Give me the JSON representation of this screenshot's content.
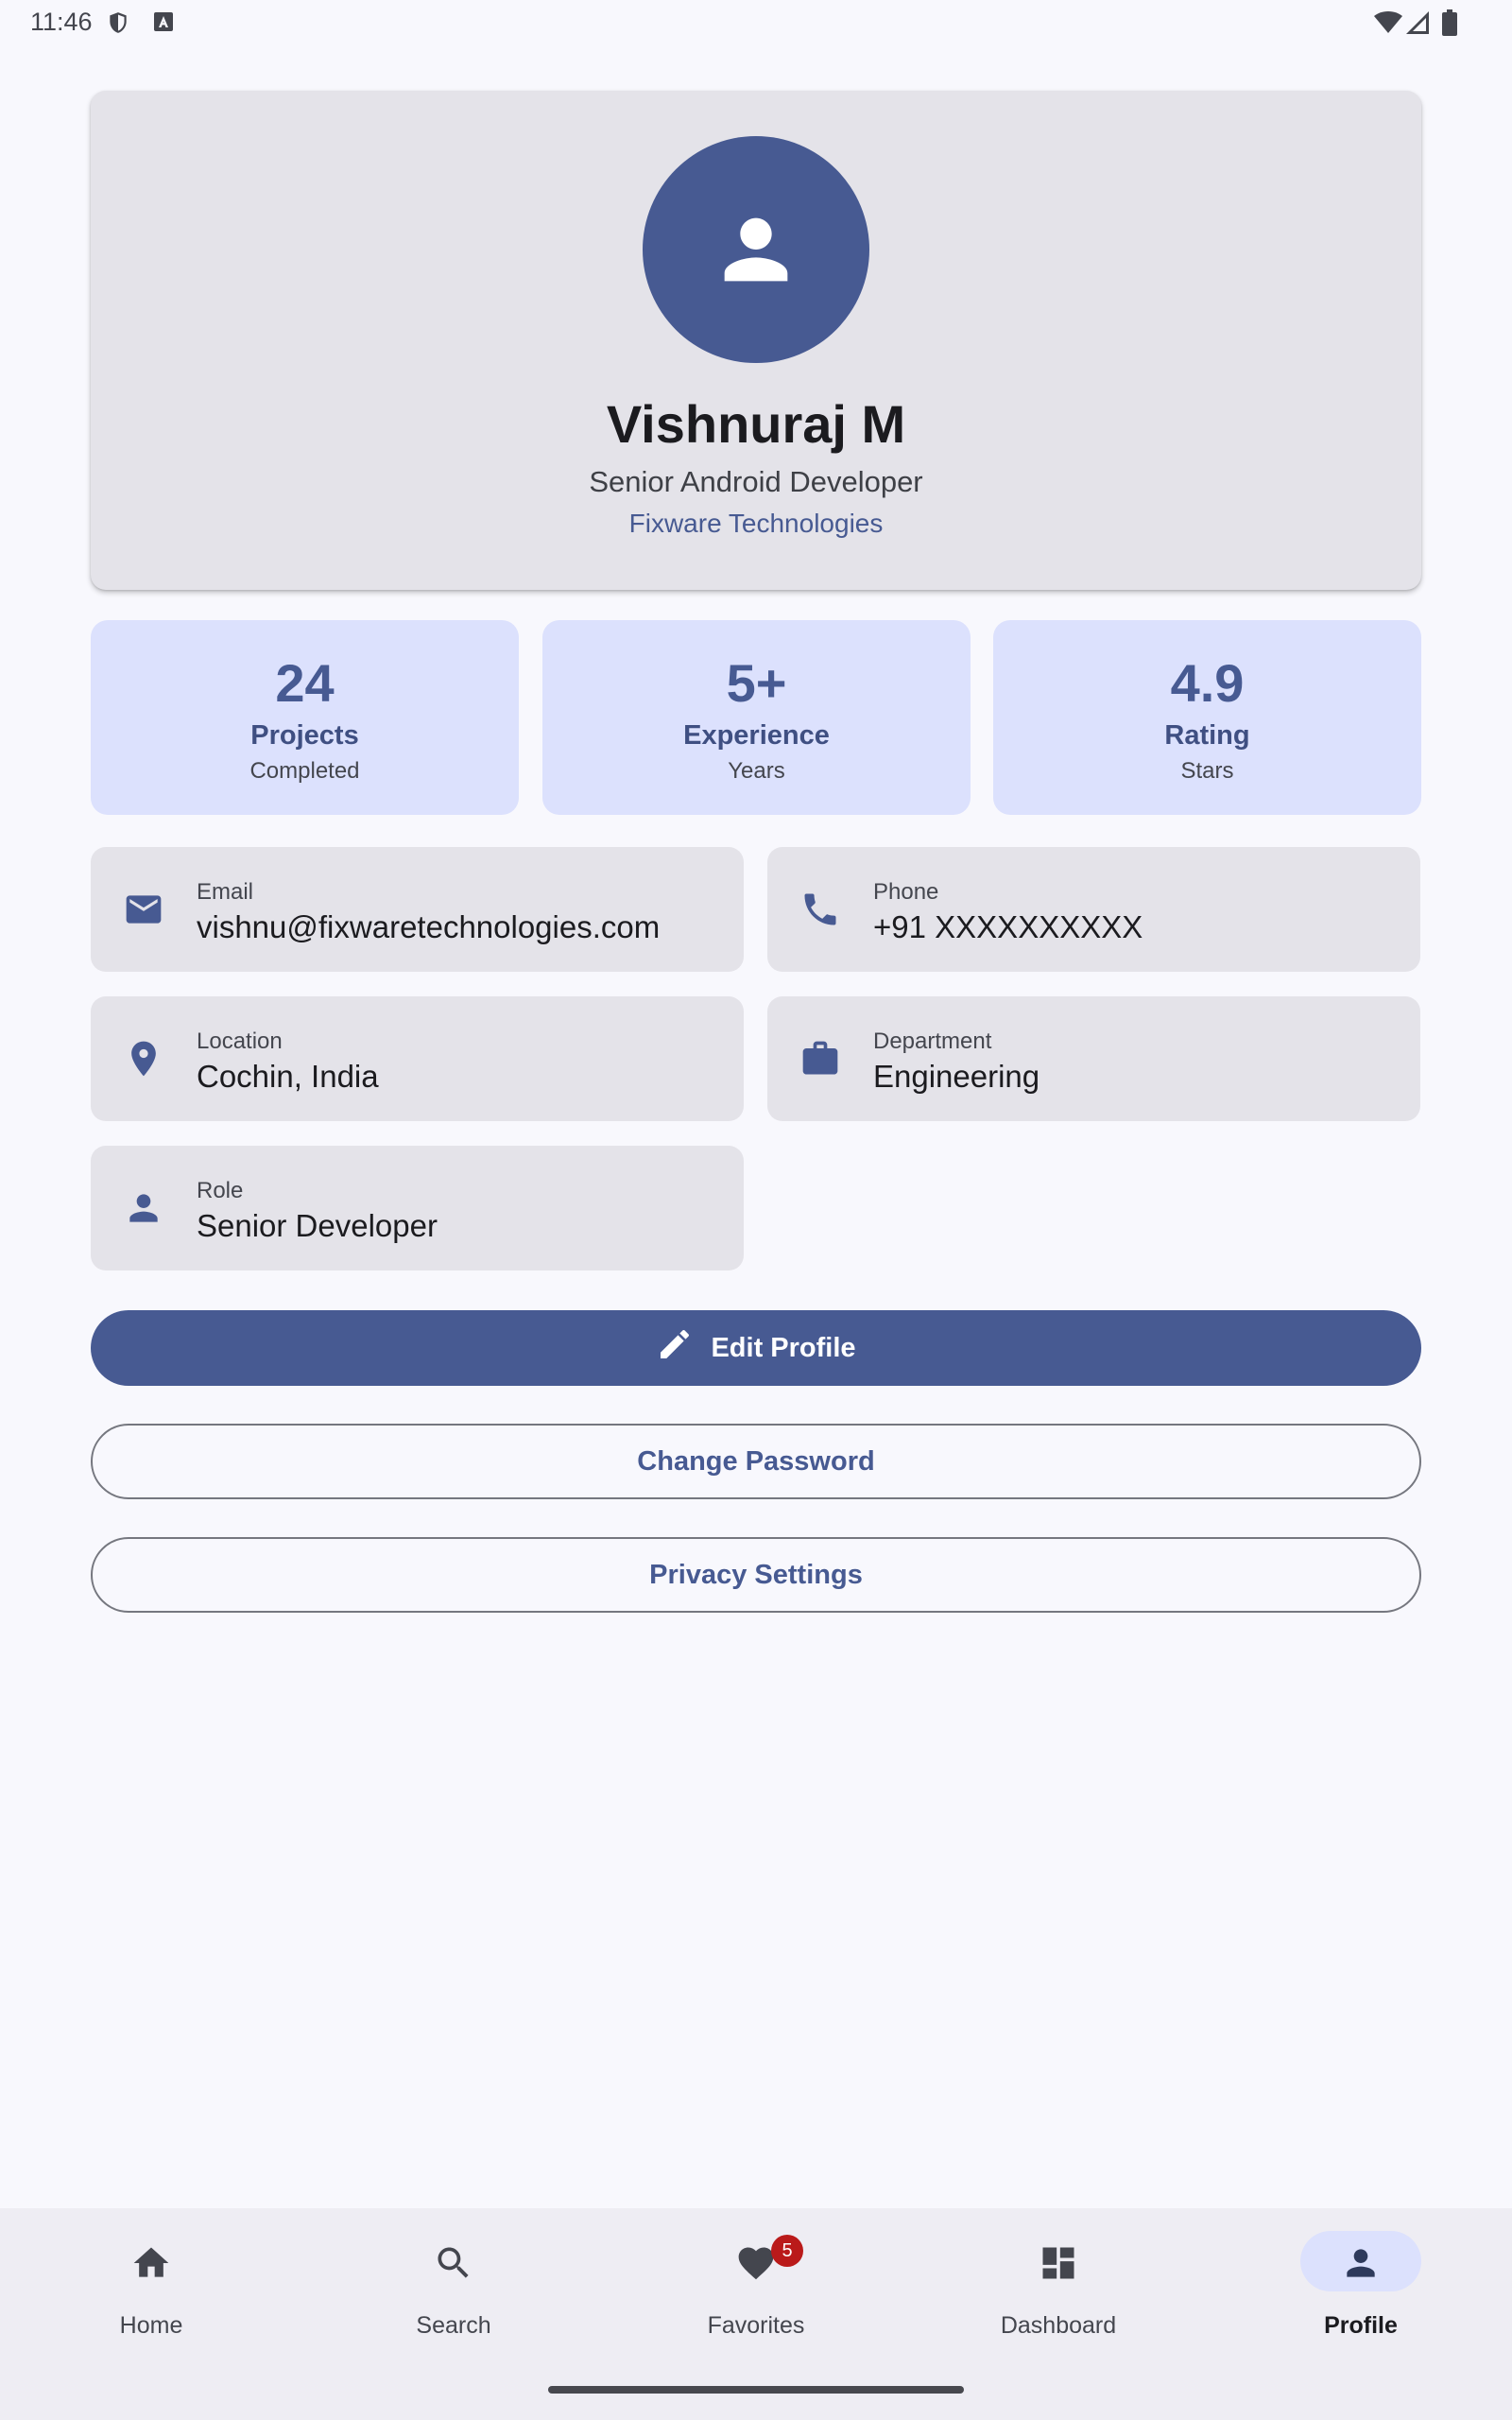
{
  "status_bar": {
    "time": "11:46",
    "left_icons": [
      "shield-icon",
      "a-icon"
    ],
    "right_icons": [
      "wifi-icon",
      "signal-icon",
      "battery-icon"
    ]
  },
  "profile": {
    "name": "Vishnuraj M",
    "title": "Senior Android Developer",
    "company": "Fixware Technologies",
    "avatar_icon": "person-icon"
  },
  "stats": [
    {
      "value": "24",
      "label": "Projects",
      "sub": "Completed"
    },
    {
      "value": "5+",
      "label": "Experience",
      "sub": "Years"
    },
    {
      "value": "4.9",
      "label": "Rating",
      "sub": "Stars"
    }
  ],
  "info": [
    {
      "icon": "email-icon",
      "label": "Email",
      "value": "vishnu@fixwaretechnologies.com"
    },
    {
      "icon": "phone-icon",
      "label": "Phone",
      "value": "+91 XXXXXXXXXX"
    },
    {
      "icon": "location-icon",
      "label": "Location",
      "value": "Cochin, India"
    },
    {
      "icon": "briefcase-icon",
      "label": "Department",
      "value": "Engineering"
    },
    {
      "icon": "person-icon",
      "label": "Role",
      "value": "Senior Developer"
    }
  ],
  "actions": {
    "edit_profile": "Edit Profile",
    "change_password": "Change Password",
    "privacy_settings": "Privacy Settings"
  },
  "bottom_nav": {
    "items": [
      {
        "label": "Home",
        "icon": "home-icon"
      },
      {
        "label": "Search",
        "icon": "search-icon"
      },
      {
        "label": "Favorites",
        "icon": "heart-icon",
        "badge": "5"
      },
      {
        "label": "Dashboard",
        "icon": "dashboard-icon"
      },
      {
        "label": "Profile",
        "icon": "person-icon",
        "active": true
      }
    ]
  },
  "colors": {
    "primary": "#475a92",
    "primary_container": "#dce1fd",
    "surface_variant": "#e4e3e9",
    "background": "#f8f8fd",
    "badge": "#ba1a1a"
  }
}
